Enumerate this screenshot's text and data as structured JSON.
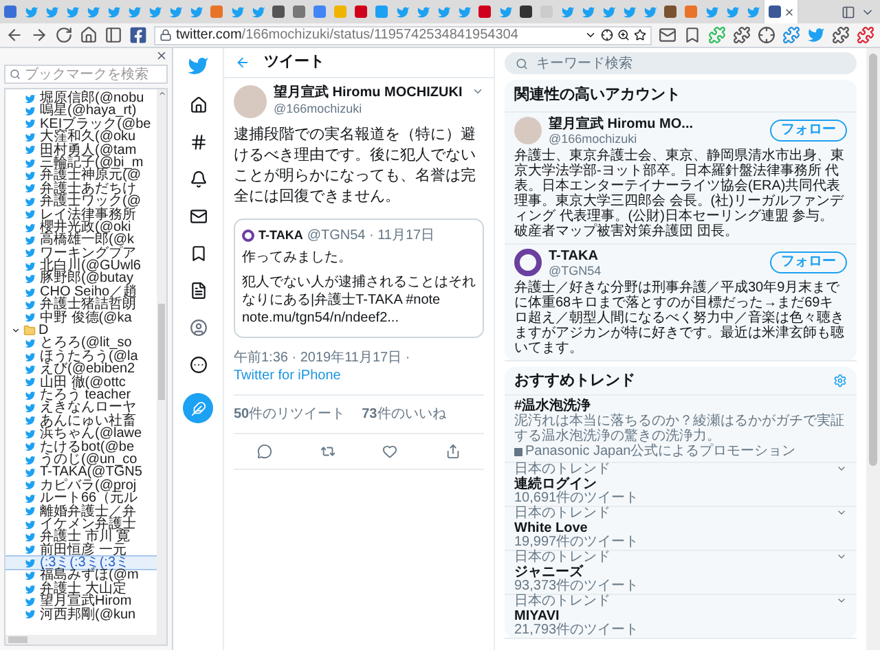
{
  "browser": {
    "tabs": [
      {
        "kind": "site",
        "color": "#3b6fd6",
        "selected": false
      },
      {
        "kind": "bird",
        "selected": false
      },
      {
        "kind": "bird",
        "selected": false
      },
      {
        "kind": "bird",
        "selected": false
      },
      {
        "kind": "bird",
        "selected": false
      },
      {
        "kind": "bird",
        "selected": false
      },
      {
        "kind": "bird",
        "selected": false
      },
      {
        "kind": "bird",
        "selected": false
      },
      {
        "kind": "bird",
        "selected": false
      },
      {
        "kind": "bird",
        "selected": false
      },
      {
        "kind": "site",
        "color": "#e8742a",
        "selected": false
      },
      {
        "kind": "bird",
        "selected": false
      },
      {
        "kind": "bird",
        "selected": false
      },
      {
        "kind": "site",
        "color": "#555555",
        "selected": false
      },
      {
        "kind": "site",
        "color": "#777777",
        "selected": false
      },
      {
        "kind": "site",
        "color": "#4285f4",
        "selected": false
      },
      {
        "kind": "site",
        "color": "#f0b400",
        "selected": false
      },
      {
        "kind": "site",
        "color": "#d0021b",
        "selected": false
      },
      {
        "kind": "site",
        "color": "#1da1f2",
        "selected": false
      },
      {
        "kind": "bird",
        "selected": false
      },
      {
        "kind": "bird",
        "selected": false
      },
      {
        "kind": "bird",
        "selected": false
      },
      {
        "kind": "bird",
        "selected": false
      },
      {
        "kind": "site",
        "color": "#d0021b",
        "selected": false
      },
      {
        "kind": "bird",
        "selected": false
      },
      {
        "kind": "site",
        "color": "#333333",
        "selected": false
      },
      {
        "kind": "site",
        "color": "#cccccc",
        "selected": false
      },
      {
        "kind": "bird",
        "selected": false
      },
      {
        "kind": "bird",
        "selected": false
      },
      {
        "kind": "bird",
        "selected": false
      },
      {
        "kind": "bird",
        "selected": false
      },
      {
        "kind": "bird",
        "selected": false
      },
      {
        "kind": "site",
        "color": "#7a5230",
        "selected": false
      },
      {
        "kind": "site",
        "color": "#e8742a",
        "selected": false
      },
      {
        "kind": "bird",
        "selected": false
      },
      {
        "kind": "bird",
        "selected": false
      },
      {
        "kind": "bird",
        "selected": false
      },
      {
        "kind": "site",
        "color": "#3b5998",
        "selected": true
      }
    ],
    "url_host": "twitter.com",
    "url_path": "/166mochizuki/status/1195742534841954304"
  },
  "sidebar": {
    "search": {
      "placeholder": "ブックマークを検索"
    },
    "items": [
      {
        "kind": "bookmark",
        "label": "堀原信郎(@nobu",
        "selected": false
      },
      {
        "kind": "bookmark",
        "label": "嗚星(@haya_rt)",
        "selected": false
      },
      {
        "kind": "bookmark",
        "label": "KEIブラック(@be",
        "selected": false
      },
      {
        "kind": "bookmark",
        "label": "大窪和久(@oku",
        "selected": false
      },
      {
        "kind": "bookmark",
        "label": "田村勇人(@tam",
        "selected": false
      },
      {
        "kind": "bookmark",
        "label": "三輪記子(@bi_m",
        "selected": false
      },
      {
        "kind": "bookmark",
        "label": "弁護士神原元(@",
        "selected": false
      },
      {
        "kind": "bookmark",
        "label": "弁護士あだちけ",
        "selected": false
      },
      {
        "kind": "bookmark",
        "label": "弁護士ワック(@",
        "selected": false
      },
      {
        "kind": "bookmark",
        "label": "レイ法律事務所",
        "selected": false
      },
      {
        "kind": "bookmark",
        "label": "櫻井光政(@oki",
        "selected": false
      },
      {
        "kind": "bookmark",
        "label": "高橋雄一郎(@k",
        "selected": false
      },
      {
        "kind": "bookmark",
        "label": "ワーキングプア",
        "selected": false
      },
      {
        "kind": "bookmark",
        "label": "北白川(@GUwl6",
        "selected": false
      },
      {
        "kind": "bookmark",
        "label": "豚野郎(@butay",
        "selected": false
      },
      {
        "kind": "bookmark",
        "label": "CHO Seiho／趙",
        "selected": false
      },
      {
        "kind": "bookmark",
        "label": "弁護士猪詰哲朗",
        "selected": false
      },
      {
        "kind": "bookmark",
        "label": "中野 俊德(@ka",
        "selected": false
      },
      {
        "kind": "folder",
        "label": "D",
        "expanded": true,
        "children": [
          {
            "kind": "bookmark",
            "label": "とろろ(@lit_so",
            "selected": false
          },
          {
            "kind": "bookmark",
            "label": "ほうたろう(@la",
            "selected": false
          },
          {
            "kind": "bookmark",
            "label": "えび(@ebiben2",
            "selected": false
          },
          {
            "kind": "bookmark",
            "label": "山田 徹(@ottc",
            "selected": false
          },
          {
            "kind": "bookmark",
            "label": "たろう teacher",
            "selected": false
          },
          {
            "kind": "bookmark",
            "label": "えきなんローヤ",
            "selected": false
          },
          {
            "kind": "bookmark",
            "label": "あんにゅい社畜",
            "selected": false
          },
          {
            "kind": "bookmark",
            "label": "浜ちゃん(@lawe",
            "selected": false
          },
          {
            "kind": "bookmark",
            "label": "たけるbot(@be",
            "selected": false
          },
          {
            "kind": "bookmark",
            "label": "うのじ(@un_co",
            "selected": false
          },
          {
            "kind": "bookmark",
            "label": "T-TAKA(@TGN5",
            "selected": false
          },
          {
            "kind": "bookmark",
            "label": "カピバラ(@proj",
            "selected": false
          },
          {
            "kind": "bookmark",
            "label": "ルート66（元ル",
            "selected": false
          },
          {
            "kind": "bookmark",
            "label": "離婚弁護士／弁",
            "selected": false
          },
          {
            "kind": "bookmark",
            "label": "イケメン弁護士",
            "selected": false
          },
          {
            "kind": "bookmark",
            "label": "弁護士 市川 寛",
            "selected": false
          },
          {
            "kind": "bookmark",
            "label": "前田恒彦 一元",
            "selected": false
          },
          {
            "kind": "bookmark",
            "label": "(:3ミ(:3ミ(:3ミ",
            "selected": true
          },
          {
            "kind": "bookmark",
            "label": "福島みずほ(@m",
            "selected": false
          },
          {
            "kind": "bookmark",
            "label": "弁護士 大山定",
            "selected": false
          },
          {
            "kind": "bookmark",
            "label": "望月宣武Hirom",
            "selected": false
          },
          {
            "kind": "bookmark",
            "label": "河西邦剛(@kun",
            "selected": false
          }
        ]
      }
    ]
  },
  "tweet": {
    "header": "ツイート",
    "author": {
      "name": "望月宣武 Hiromu MOCHIZUKI",
      "handle": "@166mochizuki"
    },
    "text": "逮捕段階での実名報道を（特に）避けるべき理由です。後に犯人でないことが明らかになっても、名誉は完全には回復できません。",
    "quote": {
      "name": "T-TAKA",
      "meta": "@TGN54 · 11月17日",
      "lines": [
        "作ってみました。",
        "犯人でない人が逮捕されることはそれなりにある|弁護士T-TAKA #note  note.mu/tgn54/n/ndeef2..."
      ]
    },
    "timestamp": "午前1:36 · 2019年11月17日 · ",
    "source": "Twitter for iPhone",
    "stats": [
      "**50**件のリツイート",
      "**73**件のいいね"
    ]
  },
  "right": {
    "search": {
      "placeholder": "キーワード検索"
    },
    "accounts": {
      "title": "関連性の高いアカウント",
      "items": [
        {
          "name": "望月宣武 Hiromu MO...",
          "handle": "@166mochizuki",
          "button": "フォロー",
          "kind": "photo",
          "bio": "弁護士、東京弁護士会、東京、静岡県清水市出身、東京大学法学部-ヨット部卒。日本羅針盤法律事務所 代表。日本エンターテイナーライツ協会(ERA)共同代表理事。東京大学三四郎会 会長。(社)リーガルファンディング 代表理事。(公財)日本セーリング連盟 参与。破産者マップ被害対策弁護団 団長。"
        },
        {
          "name": "T-TAKA",
          "handle": "@TGN54",
          "button": "フォロー",
          "kind": "ring",
          "bio": "弁護士／好きな分野は刑事弁護／平成30年9月末までに体重68キロまで落とすのが目標だった→まだ69キロ超え／朝型人間になるべく努力中／音楽は色々聴きますがアジカンが特に好きです。最近は米津玄師も聴いてます。"
        }
      ]
    },
    "trends": {
      "title": "おすすめトレンド",
      "promoted": {
        "name": "#温水泡洗浄",
        "description": "泥汚れは本当に落ちるのか？綾瀬はるかがガチで実証する温水泡洗浄の驚きの洗浄力。",
        "promoter": "Panasonic Japan公式によるプロモーション"
      },
      "items": [
        {
          "context": "日本のトレンド",
          "name": "連続ログイン",
          "count": "10,691件のツイート"
        },
        {
          "context": "日本のトレンド",
          "name": "White Love",
          "count": "19,997件のツイート"
        },
        {
          "context": "日本のトレンド",
          "name": "ジャニーズ",
          "count": "93,373件のツイート"
        },
        {
          "context": "日本のトレンド",
          "name": "MIYAVI",
          "count": "21,793件のツイート"
        }
      ]
    }
  }
}
